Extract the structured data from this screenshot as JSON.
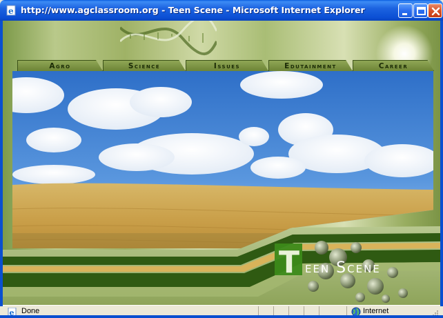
{
  "window": {
    "title": "http://www.agclassroom.org - Teen Scene - Microsoft Internet Explorer",
    "icon": "ie-page-icon",
    "controls": [
      "minimize-icon",
      "maximize-icon",
      "close-icon"
    ]
  },
  "nav": {
    "tabs": [
      {
        "label": "Agro"
      },
      {
        "label": "Science"
      },
      {
        "label": "Issues"
      },
      {
        "label": "Edutainment"
      },
      {
        "label": "Career"
      }
    ]
  },
  "branding": {
    "logo_letter": "T",
    "logo_text": "een Scene"
  },
  "statusbar": {
    "status": "Done",
    "zone": "Internet",
    "status_icon": "ie-done-icon",
    "zone_icon": "globe-icon"
  },
  "colors": {
    "titlebar": "#0b4fd4",
    "nav_tab": "#7d9440",
    "dark_green": "#2f5a12",
    "wheat": "#d9b35a",
    "sky": "#3a78d0"
  }
}
